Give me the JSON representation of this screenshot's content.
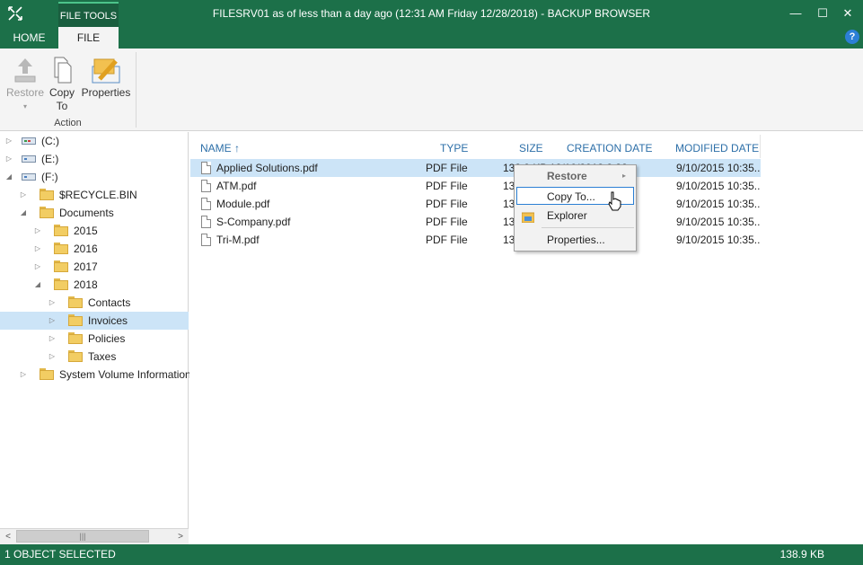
{
  "window": {
    "title": "FILESRV01 as of less than a day ago (12:31 AM Friday 12/28/2018) - BACKUP BROWSER",
    "context_tab": "FILE TOOLS",
    "controls": {
      "minimize": "—",
      "maximize": "☐",
      "close": "✕"
    }
  },
  "tabs": {
    "home": "HOME",
    "file": "FILE",
    "help": "?"
  },
  "ribbon": {
    "restore": {
      "label": "Restore",
      "dropdown": "▾"
    },
    "copy_to": {
      "label_line1": "Copy",
      "label_line2": "To"
    },
    "properties": {
      "label": "Properties"
    },
    "group_label": "Action"
  },
  "tree": {
    "items": [
      {
        "label": "(C:)",
        "type": "drive-windows",
        "expander": "▷"
      },
      {
        "label": "(E:)",
        "type": "drive",
        "expander": "▷"
      },
      {
        "label": "(F:)",
        "type": "drive",
        "expander": "◢"
      },
      {
        "label": "$RECYCLE.BIN",
        "type": "folder",
        "expander": "▷"
      },
      {
        "label": "Documents",
        "type": "folder",
        "expander": "◢"
      },
      {
        "label": "2015",
        "type": "folder",
        "expander": "▷"
      },
      {
        "label": "2016",
        "type": "folder",
        "expander": "▷"
      },
      {
        "label": "2017",
        "type": "folder",
        "expander": "▷"
      },
      {
        "label": "2018",
        "type": "folder",
        "expander": "◢"
      },
      {
        "label": "Contacts",
        "type": "folder",
        "expander": "▷"
      },
      {
        "label": "Invoices",
        "type": "folder",
        "expander": "▷"
      },
      {
        "label": "Policies",
        "type": "folder",
        "expander": "▷"
      },
      {
        "label": "Taxes",
        "type": "folder",
        "expander": "▷"
      },
      {
        "label": "System Volume Information",
        "type": "folder",
        "expander": "▷"
      }
    ],
    "selected": "Invoices",
    "scroll": {
      "left": "<",
      "thumb": "|||",
      "right": ">"
    }
  },
  "list": {
    "columns": {
      "name": "NAME",
      "sort_arrow": "↑",
      "type": "TYPE",
      "size": "SIZE",
      "created": "CREATION DATE",
      "modified": "MODIFIED DATE"
    },
    "rows": [
      {
        "name": "Applied Solutions.pdf",
        "type": "PDF  File",
        "size": "138.9 KB",
        "created": "12/10/2018 2:38...",
        "modified": "9/10/2015 10:35..."
      },
      {
        "name": "ATM.pdf",
        "type": "PDF  File",
        "size": "13",
        "created": "",
        "modified": "9/10/2015 10:35..."
      },
      {
        "name": "Module.pdf",
        "type": "PDF  File",
        "size": "13",
        "created": "",
        "modified": "9/10/2015 10:35..."
      },
      {
        "name": "S-Company.pdf",
        "type": "PDF  File",
        "size": "13",
        "created": "",
        "modified": "9/10/2015 10:35..."
      },
      {
        "name": "Tri-M.pdf",
        "type": "PDF  File",
        "size": "13",
        "created": "",
        "modified": "9/10/2015 10:35..."
      }
    ]
  },
  "context_menu": {
    "restore": "Restore",
    "restore_arrow": "▸",
    "copy_to": "Copy To...",
    "explorer": "Explorer",
    "properties": "Properties..."
  },
  "status": {
    "left": "1 OBJECT SELECTED",
    "right": "138.9 KB"
  },
  "colors": {
    "accent": "#1c7049",
    "selection": "#cce4f7",
    "header_text": "#2d6fa8"
  }
}
